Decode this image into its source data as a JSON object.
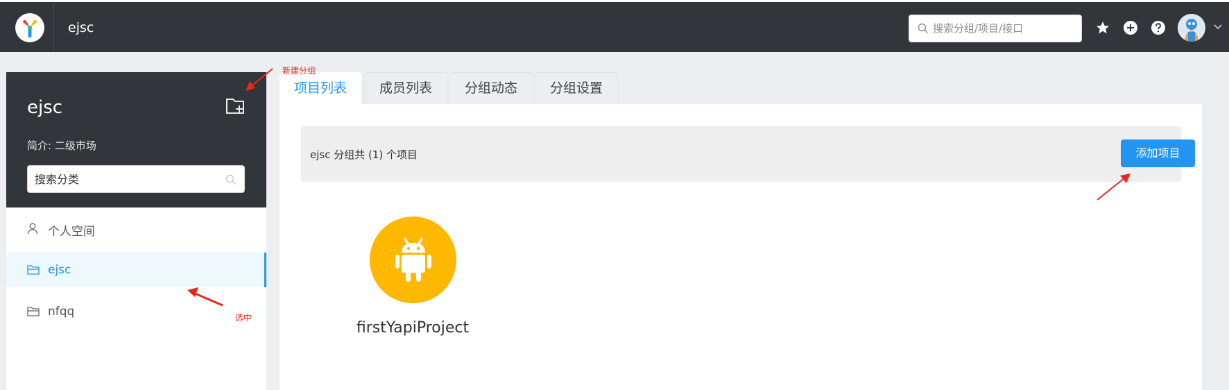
{
  "header": {
    "group_name": "ejsc",
    "search_placeholder": "搜索分组/项目/接口",
    "icons": [
      "star-icon",
      "plus-circle-icon",
      "question-circle-icon",
      "avatar",
      "chevron-down-icon"
    ]
  },
  "sidebar": {
    "title": "ejsc",
    "description": "简介: 二级市场",
    "search_placeholder": "搜索分类",
    "items": [
      {
        "label": "个人空间",
        "icon": "user-icon",
        "active": false
      },
      {
        "label": "ejsc",
        "icon": "folder-icon",
        "active": true
      },
      {
        "label": "nfqq",
        "icon": "folder-icon",
        "active": false
      }
    ]
  },
  "tabs": [
    {
      "label": "项目列表",
      "active": true
    },
    {
      "label": "成员列表",
      "active": false
    },
    {
      "label": "分组动态",
      "active": false
    },
    {
      "label": "分组设置",
      "active": false
    }
  ],
  "main": {
    "info_text": "ejsc 分组共 (1) 个项目",
    "add_button": "添加项目",
    "projects": [
      {
        "name": "firstYapiProject",
        "icon": "android-icon",
        "color": "#ffb800"
      }
    ]
  },
  "annotations": {
    "new_group": "新建分组",
    "selected": "选中"
  },
  "colors": {
    "header_bg": "#32363b",
    "accent": "#2395f1",
    "project_color": "#ffb800",
    "annotation": "#e8281f"
  }
}
